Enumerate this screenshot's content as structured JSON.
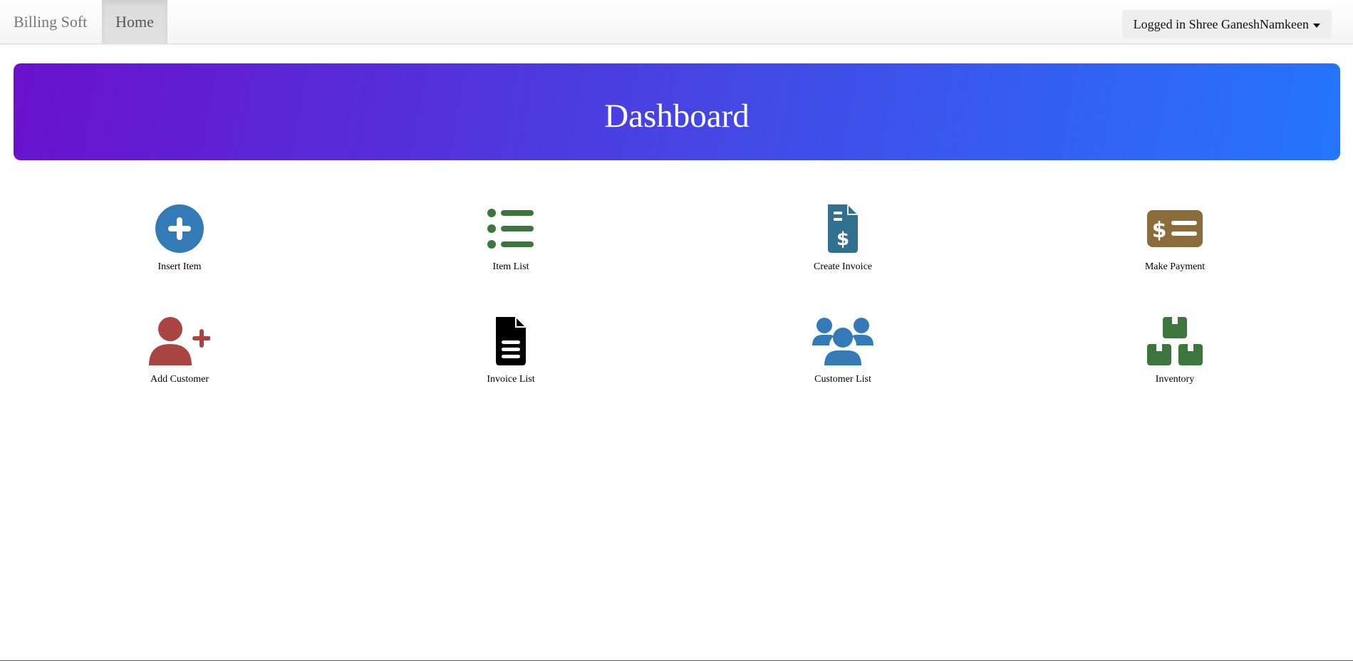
{
  "navbar": {
    "brand": "Billing Soft",
    "home": "Home",
    "user_menu": "Logged in Shree GaneshNamkeen"
  },
  "banner": {
    "title": "Dashboard"
  },
  "tiles": [
    {
      "label": "Insert Item",
      "icon": "plus-circle-icon",
      "color": "#337ab7"
    },
    {
      "label": "Item List",
      "icon": "list-icon",
      "color": "#3c763d"
    },
    {
      "label": "Create Invoice",
      "icon": "invoice-dollar-icon",
      "color": "#31708f"
    },
    {
      "label": "Make Payment",
      "icon": "money-check-icon",
      "color": "#8a6d3b"
    },
    {
      "label": "Add Customer",
      "icon": "user-plus-icon",
      "color": "#a94442"
    },
    {
      "label": "Invoice List",
      "icon": "file-lines-icon",
      "color": "#000000"
    },
    {
      "label": "Customer List",
      "icon": "users-icon",
      "color": "#337ab7"
    },
    {
      "label": "Inventory",
      "icon": "boxes-icon",
      "color": "#3c763d"
    }
  ]
}
